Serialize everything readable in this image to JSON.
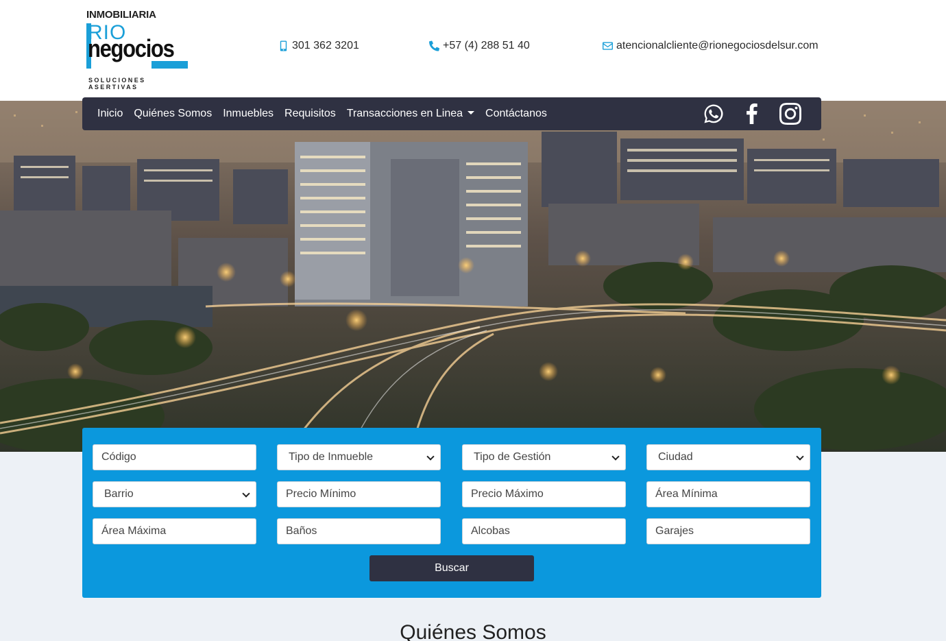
{
  "brand": {
    "top_text": "INMOBILIARIA",
    "rio_text": "RIO",
    "negocios_text": "negocios",
    "tagline": "SOLUCIONES ASERTIVAS",
    "blue": "#1a9fd8"
  },
  "contact": {
    "mobile": "301 362 3201",
    "phone": "+57 (4) 288 51 40",
    "email": "atencionalcliente@rionegociosdelsur.com"
  },
  "nav": {
    "items": [
      "Inicio",
      "Quiénes Somos",
      "Inmuebles",
      "Requisitos",
      "Transacciones en Linea",
      "Contáctanos"
    ],
    "social": [
      "whatsapp-icon",
      "facebook-icon",
      "instagram-icon"
    ],
    "bg": "#2f3142"
  },
  "search": {
    "codigo": "Código",
    "tipo_inmueble": "Tipo de Inmueble",
    "tipo_gestion": "Tipo de Gestión",
    "ciudad": "Ciudad",
    "barrio": "Barrio",
    "precio_min": "Precio Mínimo",
    "precio_max": "Precio Máximo",
    "area_min": "Área Mínima",
    "area_max": "Área Máxima",
    "banos": "Baños",
    "alcobas": "Alcobas",
    "garajes": "Garajes",
    "button": "Buscar",
    "bg": "#0b98dd"
  },
  "section": {
    "title": "Quiénes Somos"
  }
}
